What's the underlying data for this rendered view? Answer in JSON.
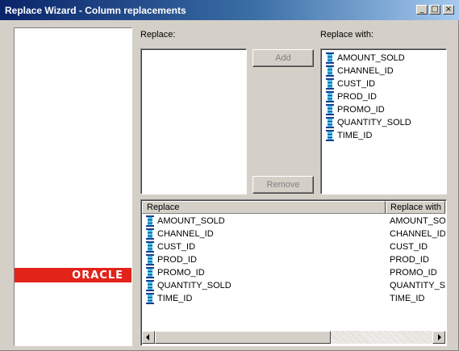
{
  "window": {
    "title": "Replace Wizard - Column replacements",
    "minimize_glyph": "_",
    "maximize_glyph": "□",
    "close_glyph": "×"
  },
  "branding": {
    "logo_text": "ORACLE",
    "banner_color": "#e2231a"
  },
  "labels": {
    "replace": "Replace:",
    "replace_with": "Replace with:"
  },
  "buttons": {
    "add": "Add",
    "remove": "Remove"
  },
  "replace_with_list": {
    "icon": "column-icon",
    "items": [
      "AMOUNT_SOLD",
      "CHANNEL_ID",
      "CUST_ID",
      "PROD_ID",
      "PROMO_ID",
      "QUANTITY_SOLD",
      "TIME_ID"
    ]
  },
  "grid": {
    "columns": [
      "Replace",
      "Replace with"
    ],
    "rows": [
      {
        "replace": "AMOUNT_SOLD",
        "replace_with": "AMOUNT_SOLD"
      },
      {
        "replace": "CHANNEL_ID",
        "replace_with": "CHANNEL_ID"
      },
      {
        "replace": "CUST_ID",
        "replace_with": "CUST_ID"
      },
      {
        "replace": "PROD_ID",
        "replace_with": "PROD_ID"
      },
      {
        "replace": "PROMO_ID",
        "replace_with": "PROMO_ID"
      },
      {
        "replace": "QUANTITY_SOLD",
        "replace_with": "QUANTITY_SOLD"
      },
      {
        "replace": "TIME_ID",
        "replace_with": "TIME_ID"
      }
    ]
  }
}
